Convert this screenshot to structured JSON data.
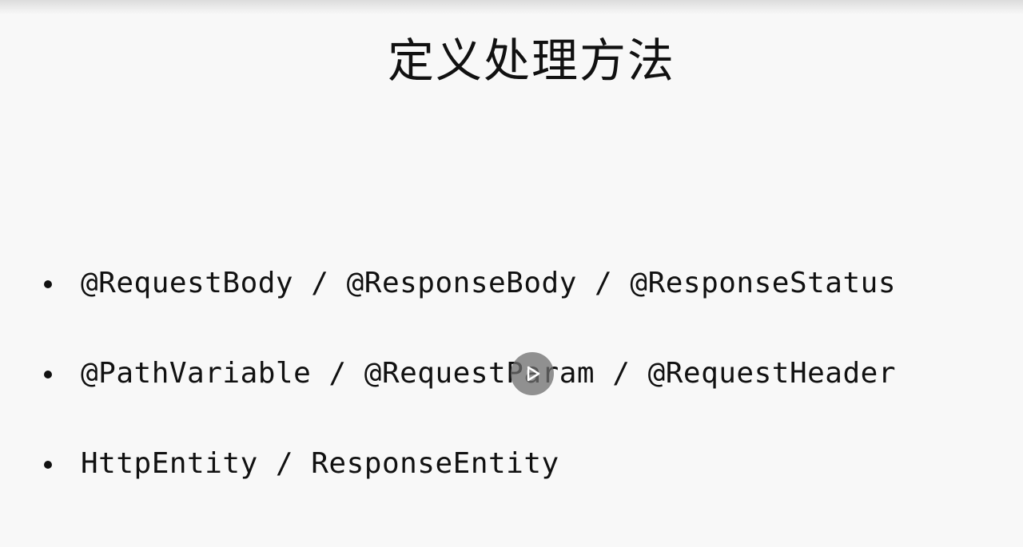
{
  "slide": {
    "title": "定义处理方法",
    "bullets": [
      "@RequestBody / @ResponseBody / @ResponseStatus",
      "@PathVariable / @RequestParam / @RequestHeader",
      "HttpEntity / ResponseEntity"
    ]
  },
  "player": {
    "play_icon": "play-icon"
  },
  "colors": {
    "background": "#f8f8f8",
    "text": "#111111",
    "play_button": "#6e6e6e"
  }
}
